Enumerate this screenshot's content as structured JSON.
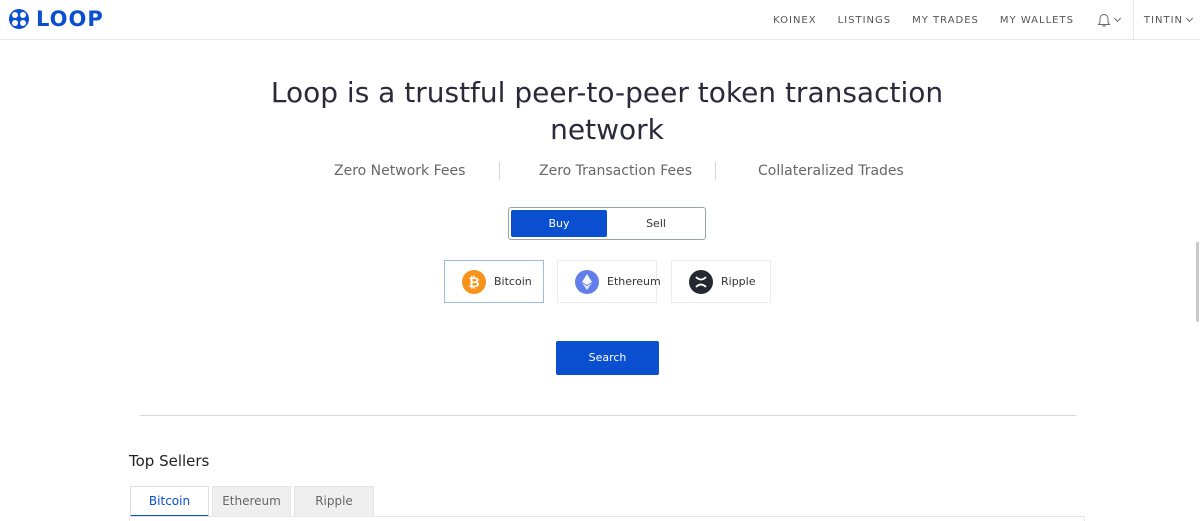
{
  "header": {
    "logo_text": "LOOP",
    "nav": [
      "KOINEX",
      "LISTINGS",
      "MY TRADES",
      "MY WALLETS"
    ],
    "user": "TINTIN"
  },
  "hero": {
    "title": "Loop is a trustful peer-to-peer token transaction network",
    "features": [
      "Zero Network Fees",
      "Zero Transaction Fees",
      "Collateralized Trades"
    ]
  },
  "trade": {
    "buy_label": "Buy",
    "sell_label": "Sell",
    "selected_mode": "Buy",
    "coins": [
      {
        "label": "Bitcoin",
        "icon": "bitcoin-icon",
        "color": "#f7931a"
      },
      {
        "label": "Ethereum",
        "icon": "ethereum-icon",
        "color": "#627eea"
      },
      {
        "label": "Ripple",
        "icon": "ripple-icon",
        "color": "#23292f"
      }
    ],
    "selected_coin": "Bitcoin",
    "search_label": "Search"
  },
  "top_sellers": {
    "title": "Top Sellers",
    "tabs": [
      "Bitcoin",
      "Ethereum",
      "Ripple"
    ],
    "active_tab": "Bitcoin"
  },
  "colors": {
    "accent": "#0a4fcf"
  }
}
